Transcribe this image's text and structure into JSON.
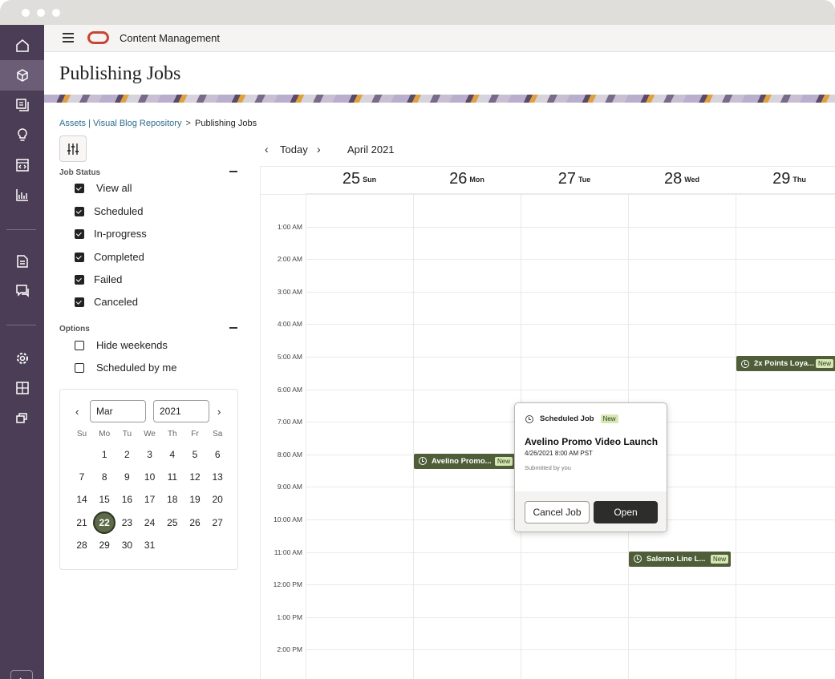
{
  "app": {
    "title": "Content Management",
    "page_title": "Publishing Jobs"
  },
  "rail": {
    "items": [
      "home-icon",
      "assets-cube-icon",
      "collections-icon",
      "insights-bulb-icon",
      "sites-icon",
      "analytics-chart-icon",
      "documents-icon",
      "conversations-icon",
      "settings-gear-icon",
      "integrations-icon",
      "developer-icon"
    ],
    "active": "assets-cube-icon"
  },
  "breadcrumb": {
    "part1": "Assets",
    "divider": "|",
    "part2": "Visual Blog Repository",
    "arrow": ">",
    "current": "Publishing Jobs"
  },
  "filters": {
    "job_status_label": "Job Status",
    "statuses": [
      {
        "label": "View all",
        "checked": true
      },
      {
        "label": "Scheduled",
        "checked": true
      },
      {
        "label": "In-progress",
        "checked": true
      },
      {
        "label": "Completed",
        "checked": true
      },
      {
        "label": "Failed",
        "checked": true
      },
      {
        "label": "Canceled",
        "checked": true
      }
    ],
    "options_label": "Options",
    "options": [
      {
        "label": "Hide weekends",
        "checked": false
      },
      {
        "label": "Scheduled by me",
        "checked": false
      }
    ]
  },
  "mini_calendar": {
    "month": "Mar",
    "year": "2021",
    "prev": "‹",
    "next": "›",
    "weekdays": [
      "Su",
      "Mo",
      "Tu",
      "We",
      "Th",
      "Fr",
      "Sa"
    ],
    "weeks": [
      [
        "",
        "1",
        "2",
        "3",
        "4",
        "5",
        "6"
      ],
      [
        "7",
        "8",
        "9",
        "10",
        "11",
        "12",
        "13"
      ],
      [
        "14",
        "15",
        "16",
        "17",
        "18",
        "19",
        "20"
      ],
      [
        "21",
        "22",
        "23",
        "24",
        "25",
        "26",
        "27"
      ],
      [
        "28",
        "29",
        "30",
        "31",
        "",
        "",
        ""
      ]
    ],
    "selected": "22"
  },
  "calendar": {
    "prev": "‹",
    "today": "Today",
    "next": "›",
    "month_label": "April 2021",
    "days": [
      {
        "num": "25",
        "dow": "Sun"
      },
      {
        "num": "26",
        "dow": "Mon"
      },
      {
        "num": "27",
        "dow": "Tue"
      },
      {
        "num": "28",
        "dow": "Wed"
      },
      {
        "num": "29",
        "dow": "Thu"
      }
    ],
    "hours": [
      "1:00 AM",
      "2:00 AM",
      "3:00 AM",
      "4:00 AM",
      "5:00 AM",
      "6:00 AM",
      "7:00 AM",
      "8:00 AM",
      "9:00 AM",
      "10:00 AM",
      "11:00 AM",
      "12:00 PM",
      "1:00 PM",
      "2:00 PM"
    ],
    "events": [
      {
        "title": "Avelino Promo...",
        "badge": "New",
        "day": "Mon",
        "hour": "8:00 AM"
      },
      {
        "title": "2x Points Loya...",
        "badge": "New",
        "day": "Thu",
        "hour": "5:00 AM"
      },
      {
        "title": "Salerno Line L...",
        "badge": "New",
        "day": "Wed",
        "hour": "11:00 AM"
      }
    ]
  },
  "popover": {
    "header": "Scheduled Job",
    "badge": "New",
    "title": "Avelino Promo Video Launch",
    "time": "4/26/2021 8:00 AM PST",
    "submitted": "Submitted by you",
    "cancel": "Cancel Job",
    "open": "Open"
  }
}
